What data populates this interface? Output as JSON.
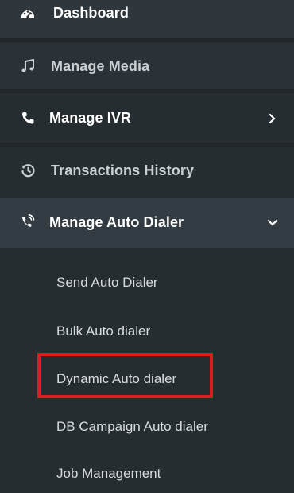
{
  "sidebar": {
    "items": [
      {
        "label": "Dashboard",
        "icon": "dashboard-icon"
      },
      {
        "label": "Manage Media",
        "icon": "music-note-icon"
      },
      {
        "label": "Manage IVR",
        "icon": "phone-icon",
        "chevron": "chevron-right-icon"
      },
      {
        "label": "Transactions History",
        "icon": "history-icon"
      },
      {
        "label": "Manage Auto Dialer",
        "icon": "phone-ringing-icon",
        "chevron": "chevron-down-icon",
        "expanded": true
      }
    ],
    "submenu": [
      {
        "label": "Send Auto Dialer"
      },
      {
        "label": "Bulk Auto dialer"
      },
      {
        "label": "Dynamic Auto dialer",
        "highlighted": true
      },
      {
        "label": "DB Campaign Auto dialer"
      },
      {
        "label": "Job Management"
      }
    ]
  },
  "colors": {
    "background": "#262d31",
    "active_item": "#333c42",
    "text_primary": "#ffffff",
    "text_secondary": "#c9cfd3",
    "highlight_border": "#e01b22"
  }
}
